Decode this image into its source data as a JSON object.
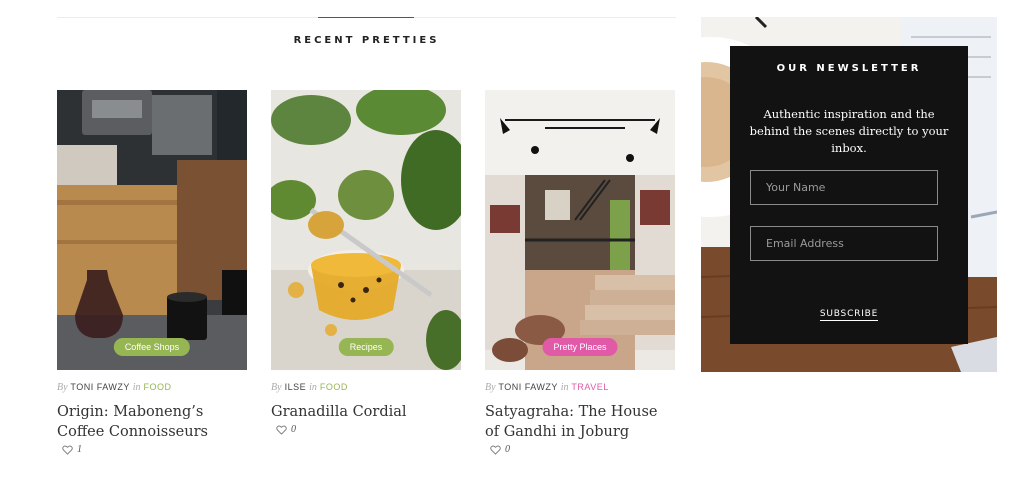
{
  "section_title": "RECENT PRETTIES",
  "posts": [
    {
      "category_pill": "Coffee Shops",
      "by": "By",
      "author": "TONI FAWZY",
      "in": "in",
      "category": "FOOD",
      "title": "Origin: Maboneng’s Coffee Connoisseurs",
      "likes": "1"
    },
    {
      "category_pill": "Recipes",
      "by": "By",
      "author": "ILSE",
      "in": "in",
      "category": "FOOD",
      "title": "Granadilla Cordial",
      "likes": "0"
    },
    {
      "category_pill": "Pretty Places",
      "by": "By",
      "author": "TONI FAWZY",
      "in": "in",
      "category": "TRAVEL",
      "title": "Satyagraha: The House of Gandhi in Joburg",
      "likes": "0"
    }
  ],
  "newsletter": {
    "title": "OUR NEWSLETTER",
    "text": "Authentic inspiration and the behind the scenes directly to your inbox.",
    "name_placeholder": "Your Name",
    "email_placeholder": "Email Address",
    "submit_label": "SUBSCRIBE"
  },
  "colors": {
    "food_green": "#96b553",
    "travel_pink": "#e05aa8",
    "newsletter_bg": "#121212"
  },
  "icons": {
    "likes": "heart-outline-icon"
  }
}
